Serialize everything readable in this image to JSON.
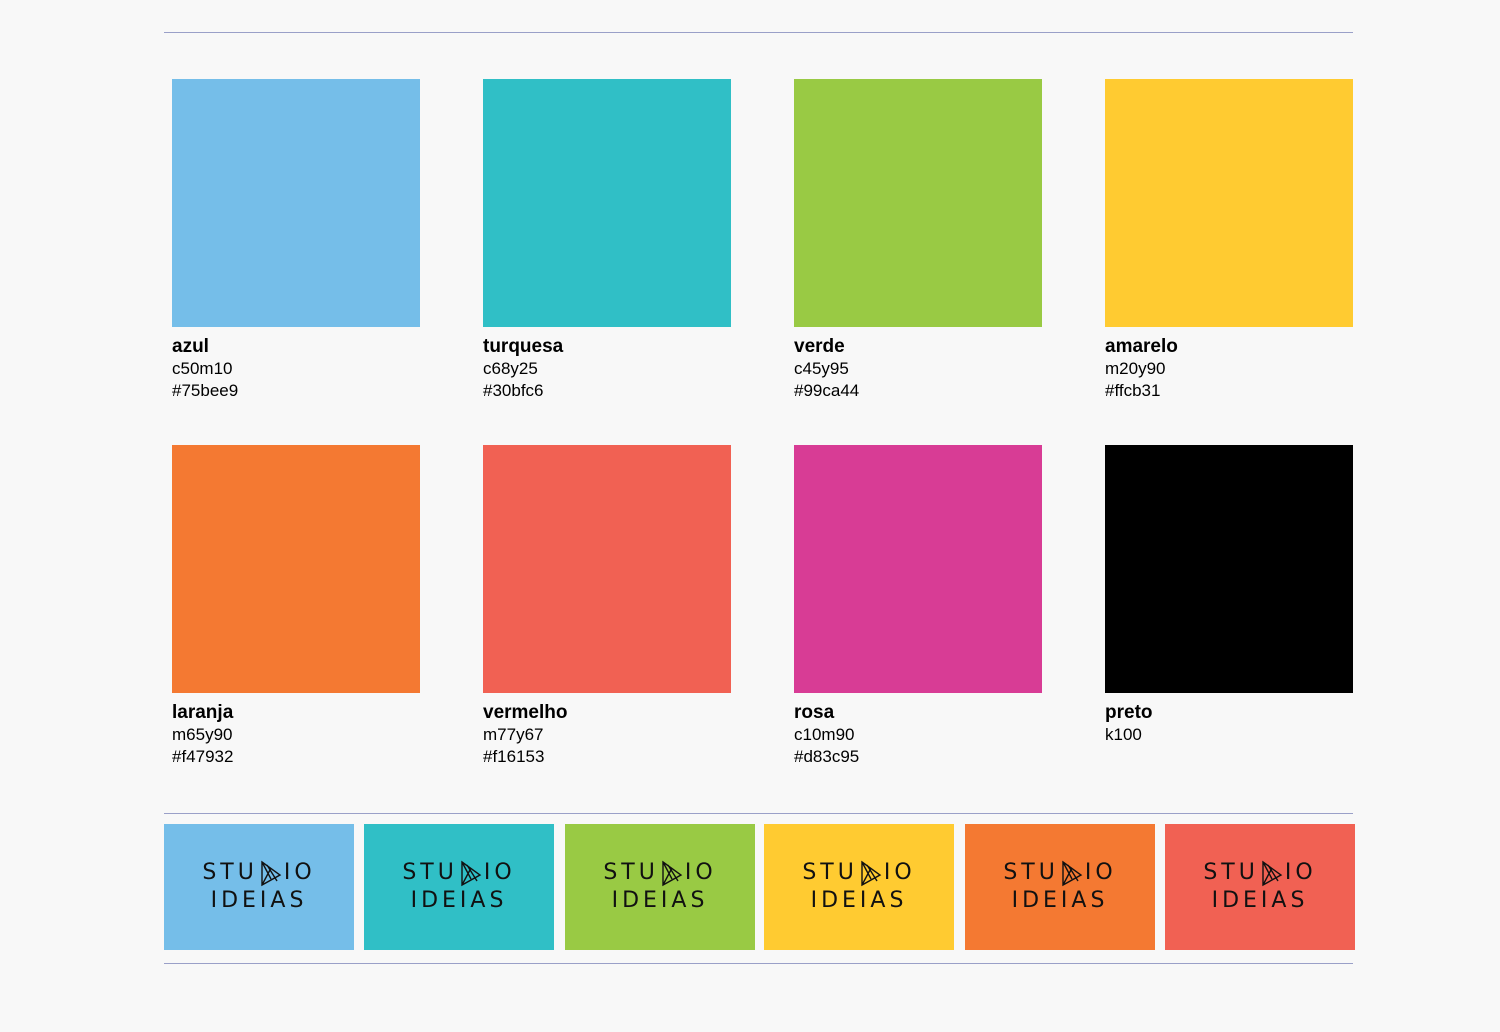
{
  "swatches": [
    {
      "name": "azul",
      "code1": "c50m10",
      "code2": "#75bee9",
      "color": "#75bee9"
    },
    {
      "name": "turquesa",
      "code1": "c68y25",
      "code2": "#30bfc6",
      "color": "#30bfc6"
    },
    {
      "name": "verde",
      "code1": "c45y95",
      "code2": "#99ca44",
      "color": "#99ca44"
    },
    {
      "name": "amarelo",
      "code1": "m20y90",
      "code2": "#ffcb31",
      "color": "#ffcb31"
    },
    {
      "name": "laranja",
      "code1": "m65y90",
      "code2": "#f47932",
      "color": "#f47932"
    },
    {
      "name": "vermelho",
      "code1": "m77y67",
      "code2": "#f16153",
      "color": "#f16153"
    },
    {
      "name": "rosa",
      "code1": "c10m90",
      "code2": "#d83c95",
      "color": "#d83c95"
    },
    {
      "name": "preto",
      "code1": "k100",
      "code2": "",
      "color": "#000000"
    }
  ],
  "logos": {
    "line1_left": "STU",
    "line1_right": "IO",
    "line2": "IDEIAS",
    "tile_colors": [
      "#75bee9",
      "#30bfc6",
      "#99ca44",
      "#ffcb31",
      "#f47932",
      "#f16153"
    ]
  }
}
